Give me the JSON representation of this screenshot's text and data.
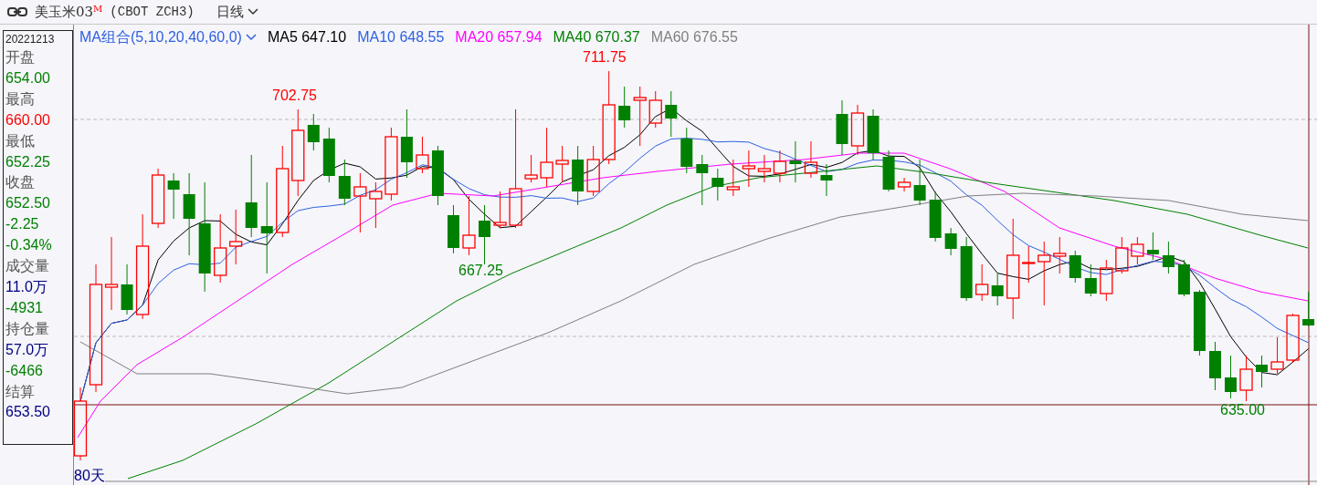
{
  "header": {
    "name": "美玉米03",
    "marker": "M",
    "code": "(CBOT ZCH3)",
    "period": "日线"
  },
  "info_panel": {
    "date": "20221213",
    "fields": [
      {
        "label": "开盘",
        "value": "654.00",
        "color": "#008000"
      },
      {
        "label": "最高",
        "value": "660.00",
        "color": "#ff0000"
      },
      {
        "label": "最低",
        "value": "652.25",
        "color": "#008000"
      },
      {
        "label": "收盘",
        "value": "652.50",
        "color": "#008000"
      },
      {
        "value": "-2.25",
        "color": "#008000"
      },
      {
        "value": "-0.34%",
        "color": "#008000"
      },
      {
        "label": "成交量",
        "value": "11.0万",
        "color": "#000080"
      },
      {
        "value": "-4931",
        "color": "#008000"
      },
      {
        "label": "持仓量",
        "value": "57.0万",
        "color": "#000080"
      },
      {
        "value": "-6466",
        "color": "#008000"
      },
      {
        "label": "结算",
        "value": "653.50",
        "color": "#000080"
      }
    ]
  },
  "chart": {
    "indicator": "MA组合(5,10,20,40,60,0)",
    "legend": [
      {
        "label": "MA5 647.10",
        "color": "#000000"
      },
      {
        "label": "MA10 648.55",
        "color": "#3060e0"
      },
      {
        "label": "MA20 657.94",
        "color": "#ff00ff"
      },
      {
        "label": "MA40 670.37",
        "color": "#008000"
      },
      {
        "label": "MA60 676.55",
        "color": "#808080"
      }
    ],
    "price_labels": [
      {
        "text": "702.75",
        "color": "#ff0000"
      },
      {
        "text": "711.75",
        "color": "#ff0000"
      },
      {
        "text": "667.25",
        "color": "#008000"
      },
      {
        "text": "635.00",
        "color": "#008000"
      }
    ],
    "period_count": "80天"
  }
}
